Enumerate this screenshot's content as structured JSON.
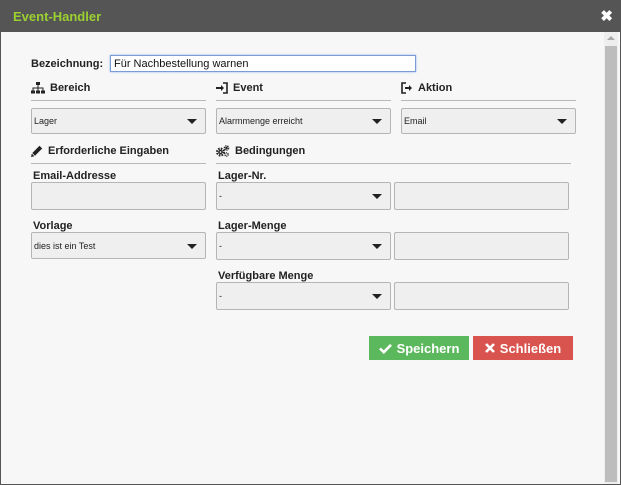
{
  "window": {
    "title": "Event-Handler"
  },
  "form": {
    "name_label": "Bezeichnung:",
    "name_value": "Für Nachbestellung warnen"
  },
  "sections": {
    "bereich": {
      "label": "Bereich",
      "value": "Lager"
    },
    "event": {
      "label": "Event",
      "value": "Alarmmenge erreicht"
    },
    "aktion": {
      "label": "Aktion",
      "value": "Email"
    },
    "inputs": {
      "label": "Erforderliche Eingaben"
    },
    "conditions": {
      "label": "Bedingungen"
    }
  },
  "required_inputs": {
    "email_label": "Email-Addresse",
    "email_value": "",
    "template_label": "Vorlage",
    "template_value": "dies ist ein Test"
  },
  "conditions": {
    "lager_nr": {
      "label": "Lager-Nr.",
      "operator": "-",
      "value": ""
    },
    "lager_menge": {
      "label": "Lager-Menge",
      "operator": "-",
      "value": ""
    },
    "verfuegbare_menge": {
      "label": "Verfügbare Menge",
      "operator": "-",
      "value": ""
    }
  },
  "buttons": {
    "save": "Speichern",
    "close": "Schließen"
  },
  "colors": {
    "title": "#9bd031",
    "save": "#5cb85c",
    "close": "#d9534f",
    "titlebar": "#555555"
  }
}
